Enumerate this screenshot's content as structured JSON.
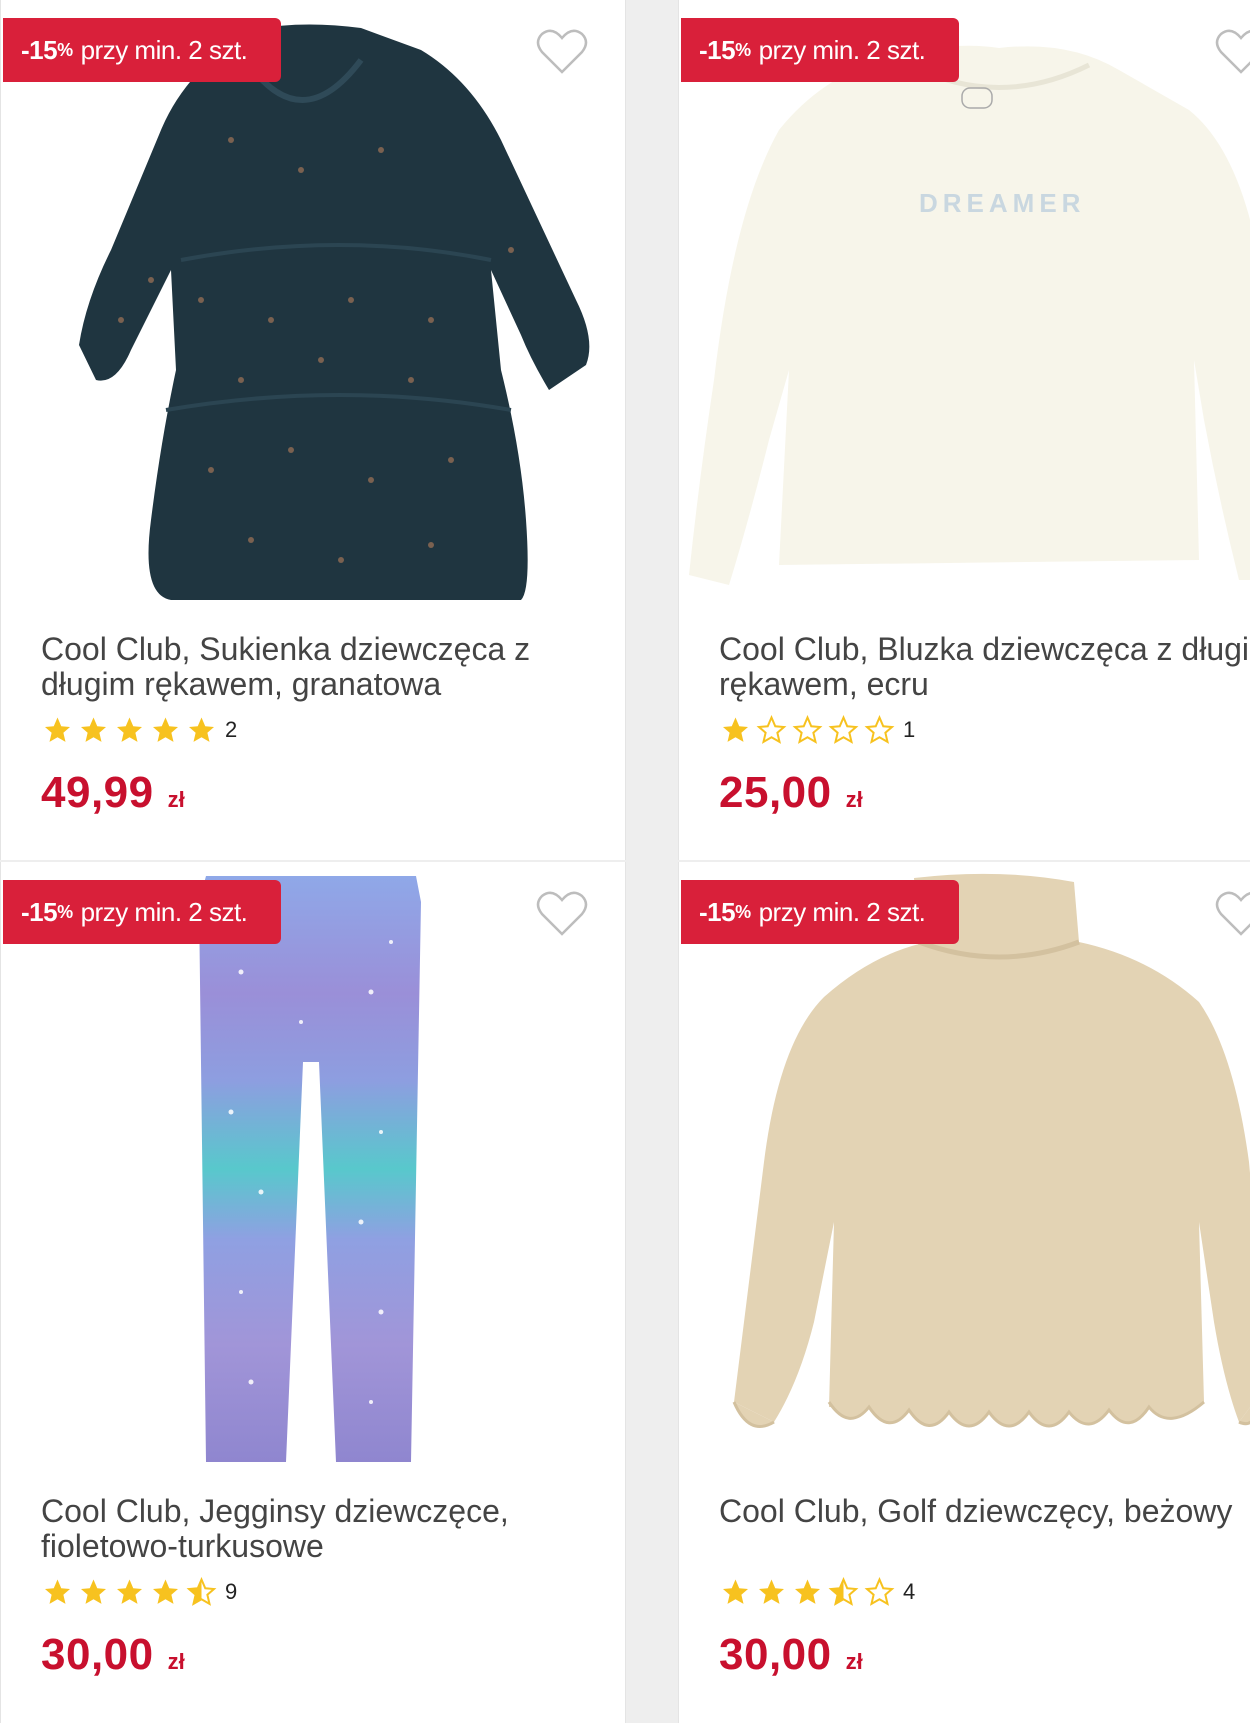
{
  "products": [
    {
      "badge": {
        "pct_value": "-15",
        "pct_sign": "%",
        "text": "przy min. 2 szt."
      },
      "title": "Cool Club, Sukienka dziewczęca z długim rękawem, granatowa",
      "rating": {
        "stars": 5,
        "count": "2"
      },
      "price": {
        "amount": "49,99",
        "currency": "zł"
      },
      "image_icon": "navy-dress-image"
    },
    {
      "badge": {
        "pct_value": "-15",
        "pct_sign": "%",
        "text": "przy min. 2 szt."
      },
      "title": "Cool Club, Bluzka dziewczęca z długim rękawem, ecru",
      "rating": {
        "stars": 1,
        "count": "1"
      },
      "price": {
        "amount": "25,00",
        "currency": "zł"
      },
      "image_icon": "ecru-sweatshirt-image",
      "print_text": "DREAMER"
    },
    {
      "badge": {
        "pct_value": "-15",
        "pct_sign": "%",
        "text": "przy min. 2 szt."
      },
      "title": "Cool Club, Jegginsy dziewczęce, fioletowo-turkusowe",
      "rating": {
        "stars": 4.5,
        "count": "9"
      },
      "price": {
        "amount": "30,00",
        "currency": "zł"
      },
      "image_icon": "starry-jeggings-image"
    },
    {
      "badge": {
        "pct_value": "-15",
        "pct_sign": "%",
        "text": "przy min. 2 szt."
      },
      "title": "Cool Club, Golf dziewczęcy, beżowy",
      "rating": {
        "stars": 3.5,
        "count": "4"
      },
      "price": {
        "amount": "30,00",
        "currency": "zł"
      },
      "image_icon": "beige-turtleneck-image"
    }
  ],
  "colors": {
    "badge": "#d9203a",
    "price": "#c8102e",
    "star": "#f7c21f"
  }
}
